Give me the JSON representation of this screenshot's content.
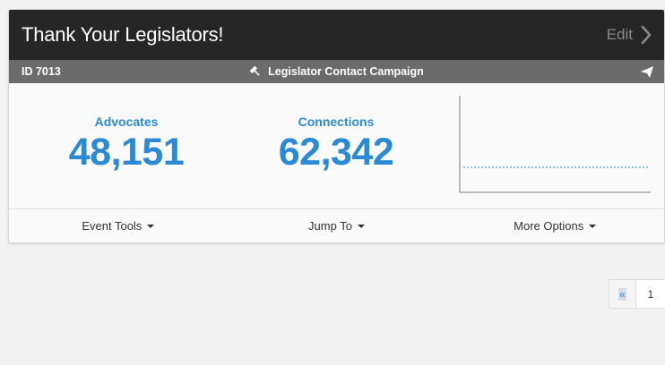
{
  "card": {
    "title": "Thank Your Legislators!",
    "edit_label": "Edit",
    "id_label": "ID 7013",
    "campaign_type": "Legislator Contact Campaign"
  },
  "stats": {
    "advocates_label": "Advocates",
    "advocates_value": "48,151",
    "connections_label": "Connections",
    "connections_value": "62,342"
  },
  "footer": {
    "event_tools": "Event Tools",
    "jump_to": "Jump To",
    "more_options": "More Options"
  },
  "pagination": {
    "prev": "«",
    "page": "1"
  },
  "colors": {
    "accent": "#2b8ad6",
    "header_bg": "#262626",
    "subheader_bg": "#6b6b6b"
  },
  "icons": {
    "campaign": "gavel-icon",
    "send": "paper-plane-icon",
    "edit": "chevron-right-icon"
  }
}
